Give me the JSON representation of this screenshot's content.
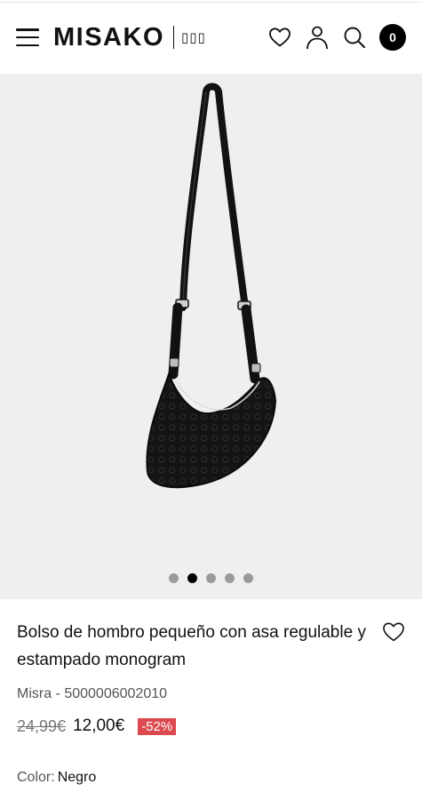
{
  "header": {
    "brand": "MISAKO",
    "brand_sub": "▯▯▯",
    "cart_count": "0",
    "icons": [
      "menu-icon",
      "heart-icon",
      "user-icon",
      "search-icon",
      "cart-icon"
    ]
  },
  "gallery": {
    "slides": 5,
    "active_slide": 2
  },
  "product": {
    "title": "Bolso de hombro pequeño con asa regulable y estampado monogram",
    "sku": "Misra - 5000006002010",
    "old_price": "24,99€",
    "price": "12,00€",
    "discount": "-52%",
    "color_label": "Color:",
    "color_value": "Negro"
  },
  "colors": {
    "discount_bg": "#dc4a4f",
    "gallery_bg": "#efefef",
    "active_dot": "#000000",
    "inactive_dot": "#9a9a9a"
  }
}
